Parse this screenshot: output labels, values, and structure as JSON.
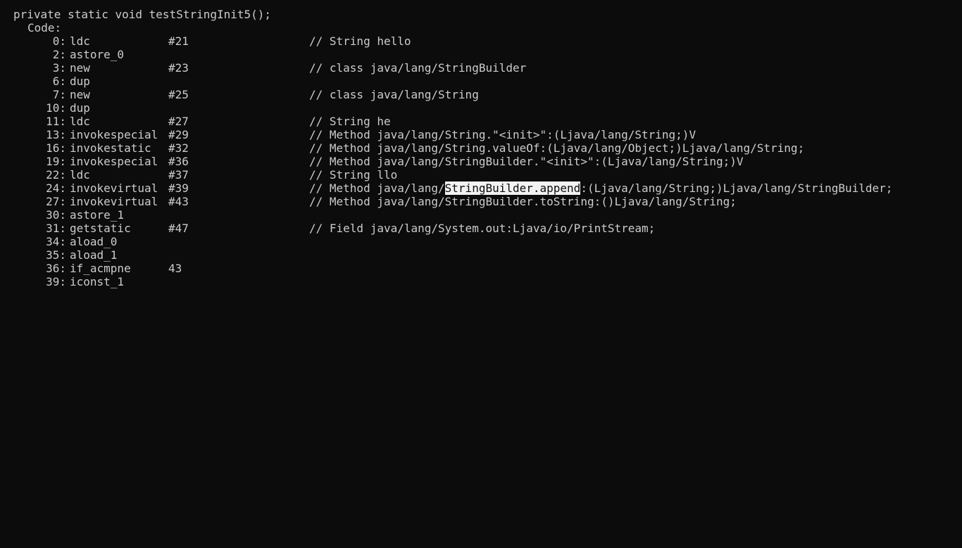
{
  "header": "private static void testStringInit5();",
  "code_label": "Code:",
  "highlight_color": "#f2f2f2",
  "background_color": "#0c0c0c",
  "text_color": "#cccccc",
  "rows": [
    {
      "offset": "0:",
      "opcode": "ldc",
      "arg": "#21",
      "comment": "// String hello"
    },
    {
      "offset": "2:",
      "opcode": "astore_0",
      "arg": "",
      "comment": ""
    },
    {
      "offset": "3:",
      "opcode": "new",
      "arg": "#23",
      "comment": "// class java/lang/StringBuilder"
    },
    {
      "offset": "6:",
      "opcode": "dup",
      "arg": "",
      "comment": ""
    },
    {
      "offset": "7:",
      "opcode": "new",
      "arg": "#25",
      "comment": "// class java/lang/String"
    },
    {
      "offset": "10:",
      "opcode": "dup",
      "arg": "",
      "comment": ""
    },
    {
      "offset": "11:",
      "opcode": "ldc",
      "arg": "#27",
      "comment": "// String he"
    },
    {
      "offset": "13:",
      "opcode": "invokespecial",
      "arg": "#29",
      "comment": "// Method java/lang/String.\"<init>\":(Ljava/lang/String;)V"
    },
    {
      "offset": "16:",
      "opcode": "invokestatic",
      "arg": "#32",
      "comment": "// Method java/lang/String.valueOf:(Ljava/lang/Object;)Ljava/lang/String;"
    },
    {
      "offset": "19:",
      "opcode": "invokespecial",
      "arg": "#36",
      "comment": "// Method java/lang/StringBuilder.\"<init>\":(Ljava/lang/String;)V"
    },
    {
      "offset": "22:",
      "opcode": "ldc",
      "arg": "#37",
      "comment": "// String llo"
    },
    {
      "offset": "24:",
      "opcode": "invokevirtual",
      "arg": "#39",
      "comment_pre": "// Method java/lang/",
      "comment_sel": "StringBuilder.append",
      "comment_post": ":(Ljava/lang/String;)Ljava/lang/StringBuilder;"
    },
    {
      "offset": "27:",
      "opcode": "invokevirtual",
      "arg": "#43",
      "comment": "// Method java/lang/StringBuilder.toString:()Ljava/lang/String;"
    },
    {
      "offset": "30:",
      "opcode": "astore_1",
      "arg": "",
      "comment": ""
    },
    {
      "offset": "31:",
      "opcode": "getstatic",
      "arg": "#47",
      "comment": "// Field java/lang/System.out:Ljava/io/PrintStream;"
    },
    {
      "offset": "34:",
      "opcode": "aload_0",
      "arg": "",
      "comment": ""
    },
    {
      "offset": "35:",
      "opcode": "aload_1",
      "arg": "",
      "comment": ""
    },
    {
      "offset": "36:",
      "opcode": "if_acmpne",
      "arg": "43",
      "comment": ""
    },
    {
      "offset": "39:",
      "opcode": "iconst_1",
      "arg": "",
      "comment": ""
    }
  ]
}
